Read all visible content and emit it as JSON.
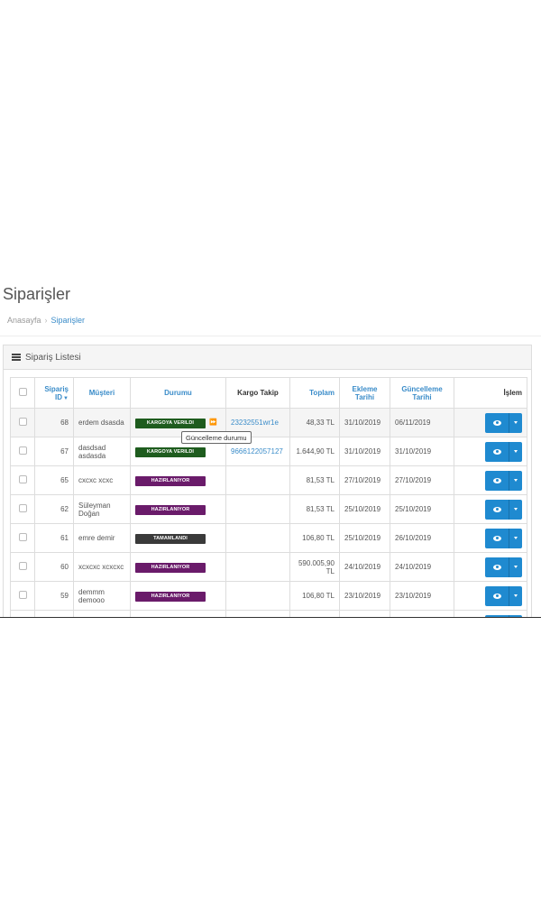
{
  "page": {
    "title": "Siparişler"
  },
  "breadcrumb": {
    "home": "Anasayfa",
    "separator": "›",
    "current": "Siparişler"
  },
  "panel": {
    "title": "Sipariş Listesi"
  },
  "table": {
    "headers": {
      "id": "Sipariş ID",
      "customer": "Müşteri",
      "status": "Durumu",
      "tracking": "Kargo Takip",
      "total": "Toplam",
      "added": "Ekleme Tarihi",
      "updated": "Güncelleme Tarihi",
      "action": "İşlem"
    },
    "rows": [
      {
        "id": "68",
        "customer": "erdem dsasda",
        "status": "KARGOYA VERILDI",
        "tracking": "23232551wr1e",
        "total": "48,33 TL",
        "added": "31/10/2019",
        "updated": "06/11/2019"
      },
      {
        "id": "67",
        "customer": "dasdsad asdasda",
        "status": "KARGOYA VERILDI",
        "tracking": "9666122057127",
        "total": "1.644,90 TL",
        "added": "31/10/2019",
        "updated": "31/10/2019"
      },
      {
        "id": "65",
        "customer": "cxcxc xcxc",
        "status": "HAZIRLANIYOR",
        "tracking": "",
        "total": "81,53 TL",
        "added": "27/10/2019",
        "updated": "27/10/2019"
      },
      {
        "id": "62",
        "customer": "Süleyman Doğan",
        "status": "HAZIRLANIYOR",
        "tracking": "",
        "total": "81,53 TL",
        "added": "25/10/2019",
        "updated": "25/10/2019"
      },
      {
        "id": "61",
        "customer": "emre demir",
        "status": "TAMAMLANDI",
        "tracking": "",
        "total": "106,80 TL",
        "added": "25/10/2019",
        "updated": "26/10/2019"
      },
      {
        "id": "60",
        "customer": "xcxcxc xcxcxc",
        "status": "HAZIRLANIYOR",
        "tracking": "",
        "total": "590.005,90 TL",
        "added": "24/10/2019",
        "updated": "24/10/2019"
      },
      {
        "id": "59",
        "customer": "demmm demooo",
        "status": "HAZIRLANIYOR",
        "tracking": "",
        "total": "106,80 TL",
        "added": "23/10/2019",
        "updated": "23/10/2019"
      }
    ]
  },
  "tooltip": {
    "text": "Güncelleme durumu"
  },
  "colors": {
    "link": "#3a8cc9",
    "status_shipped": "#1e5c1e",
    "status_preparing": "#6a1b6a",
    "status_completed": "#3a3a3a",
    "button": "#1f8ad0"
  },
  "icons": {
    "list": "list-icon",
    "view": "eye-icon",
    "dropdown": "caret-down-icon",
    "forward": "fast-forward-icon"
  }
}
